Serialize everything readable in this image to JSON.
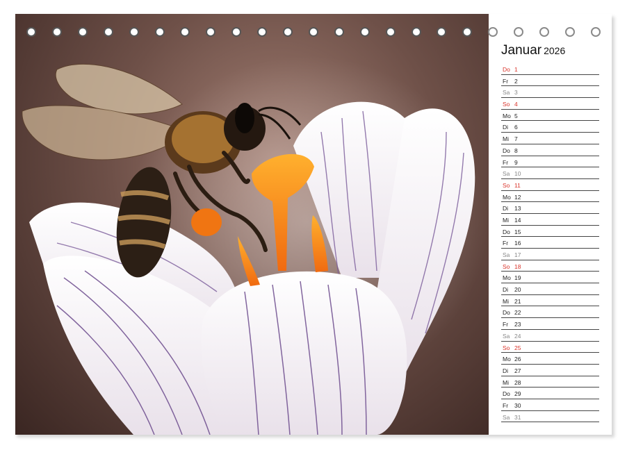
{
  "calendar": {
    "month": "Januar",
    "year": "2026",
    "days": [
      {
        "wd": "Do",
        "n": "1",
        "type": "sun"
      },
      {
        "wd": "Fr",
        "n": "2",
        "type": "wk"
      },
      {
        "wd": "Sa",
        "n": "3",
        "type": "sat"
      },
      {
        "wd": "So",
        "n": "4",
        "type": "sun"
      },
      {
        "wd": "Mo",
        "n": "5",
        "type": "wk"
      },
      {
        "wd": "Di",
        "n": "6",
        "type": "wk"
      },
      {
        "wd": "Mi",
        "n": "7",
        "type": "wk"
      },
      {
        "wd": "Do",
        "n": "8",
        "type": "wk"
      },
      {
        "wd": "Fr",
        "n": "9",
        "type": "wk"
      },
      {
        "wd": "Sa",
        "n": "10",
        "type": "sat"
      },
      {
        "wd": "So",
        "n": "11",
        "type": "sun"
      },
      {
        "wd": "Mo",
        "n": "12",
        "type": "wk"
      },
      {
        "wd": "Di",
        "n": "13",
        "type": "wk"
      },
      {
        "wd": "Mi",
        "n": "14",
        "type": "wk"
      },
      {
        "wd": "Do",
        "n": "15",
        "type": "wk"
      },
      {
        "wd": "Fr",
        "n": "16",
        "type": "wk"
      },
      {
        "wd": "Sa",
        "n": "17",
        "type": "sat"
      },
      {
        "wd": "So",
        "n": "18",
        "type": "sun"
      },
      {
        "wd": "Mo",
        "n": "19",
        "type": "wk"
      },
      {
        "wd": "Di",
        "n": "20",
        "type": "wk"
      },
      {
        "wd": "Mi",
        "n": "21",
        "type": "wk"
      },
      {
        "wd": "Do",
        "n": "22",
        "type": "wk"
      },
      {
        "wd": "Fr",
        "n": "23",
        "type": "wk"
      },
      {
        "wd": "Sa",
        "n": "24",
        "type": "sat"
      },
      {
        "wd": "So",
        "n": "25",
        "type": "sun"
      },
      {
        "wd": "Mo",
        "n": "26",
        "type": "wk"
      },
      {
        "wd": "Di",
        "n": "27",
        "type": "wk"
      },
      {
        "wd": "Mi",
        "n": "28",
        "type": "wk"
      },
      {
        "wd": "Do",
        "n": "29",
        "type": "wk"
      },
      {
        "wd": "Fr",
        "n": "30",
        "type": "wk"
      },
      {
        "wd": "Sa",
        "n": "31",
        "type": "sat"
      }
    ]
  },
  "colors": {
    "sunday": "#d9332a",
    "saturday": "#888888",
    "weekday": "#222222"
  },
  "image": {
    "subject_icon": "bee-on-crocus-illustration"
  }
}
